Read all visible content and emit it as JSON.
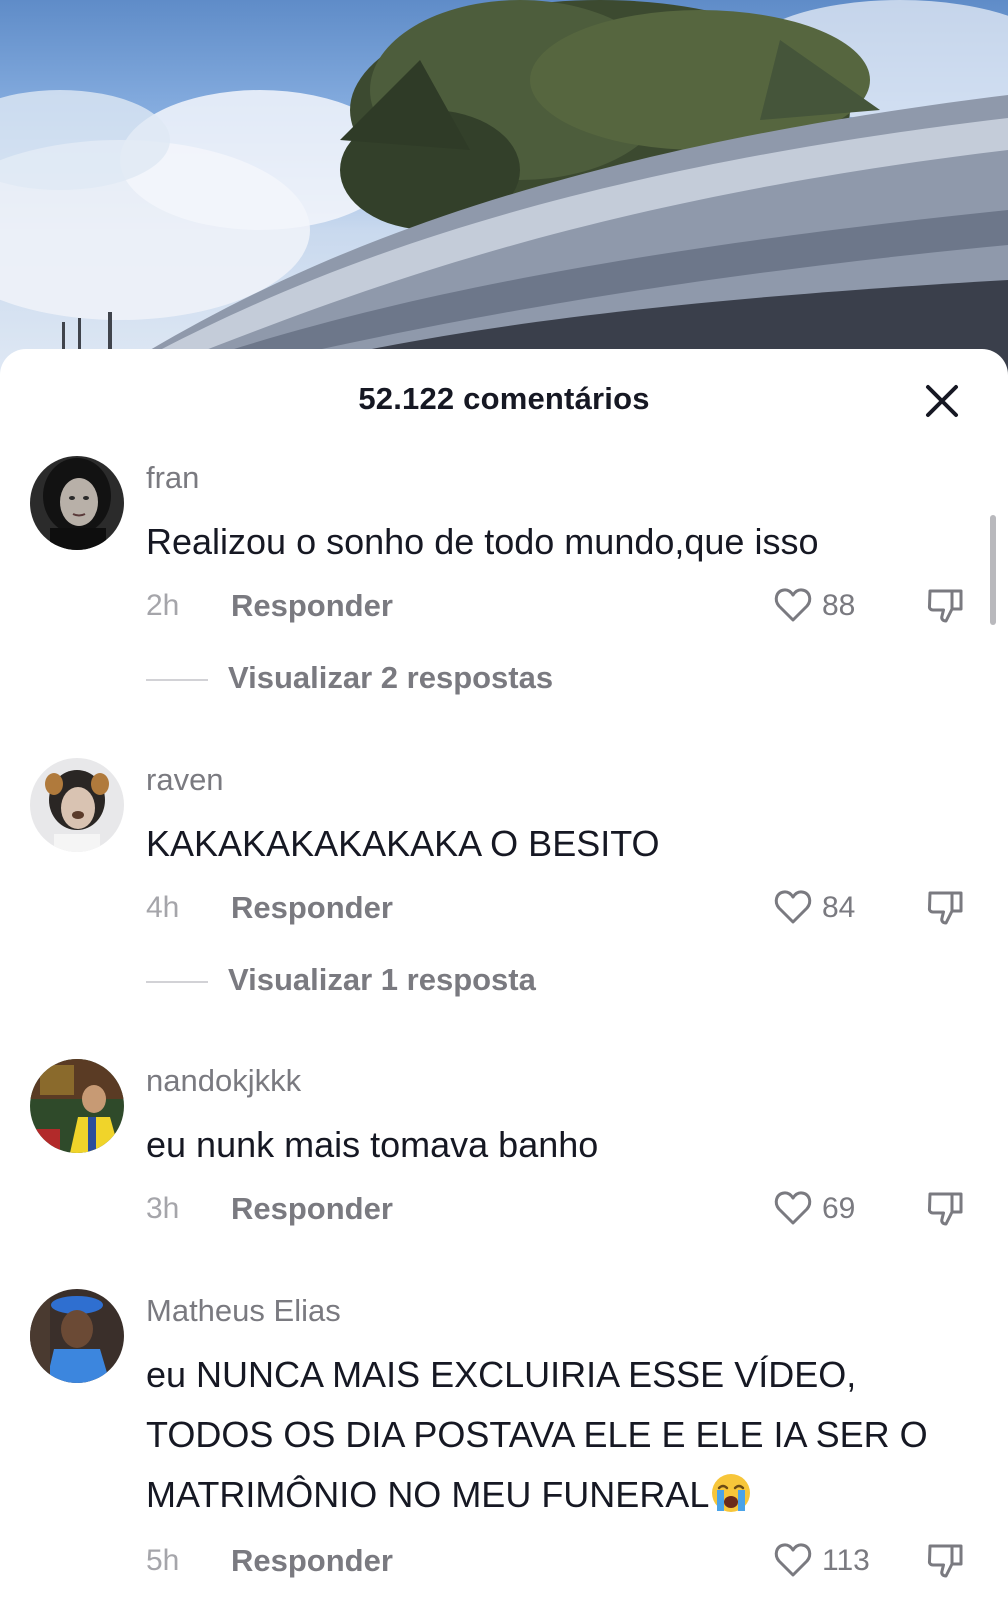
{
  "sheet": {
    "title": "52.122 comentários",
    "close_icon": "close-icon"
  },
  "comments": [
    {
      "username": "fran",
      "text": "Realizou o sonho de todo mundo,que isso",
      "time": "2h",
      "reply_label": "Responder",
      "likes": "88",
      "replies_label": "Visualizar 2 respostas"
    },
    {
      "username": "raven",
      "text": "KAKAKAKAKAKAKA O BESITO",
      "time": "4h",
      "reply_label": "Responder",
      "likes": "84",
      "replies_label": "Visualizar 1 resposta"
    },
    {
      "username": "nandokjkkk",
      "text": "eu nunk mais tomava banho",
      "time": "3h",
      "reply_label": "Responder",
      "likes": "69"
    },
    {
      "username": "Matheus Elias",
      "text": "eu NUNCA MAIS EXCLUIRIA ESSE VÍDEO, TODOS OS DIA POSTAVA ELE E ELE IA SER O MATRIMÔNIO NO MEU FUNERAL",
      "text_emoji": "😭",
      "time": "5h",
      "reply_label": "Responder",
      "likes": "113"
    }
  ],
  "colors": {
    "text_primary": "#161823",
    "text_secondary": "#7a7a80",
    "text_tertiary": "#a5a5aa"
  },
  "icons": {
    "like": "heart-outline-icon",
    "dislike": "thumbs-down-icon",
    "crying_emoji": "loudly-crying-face-emoji"
  }
}
